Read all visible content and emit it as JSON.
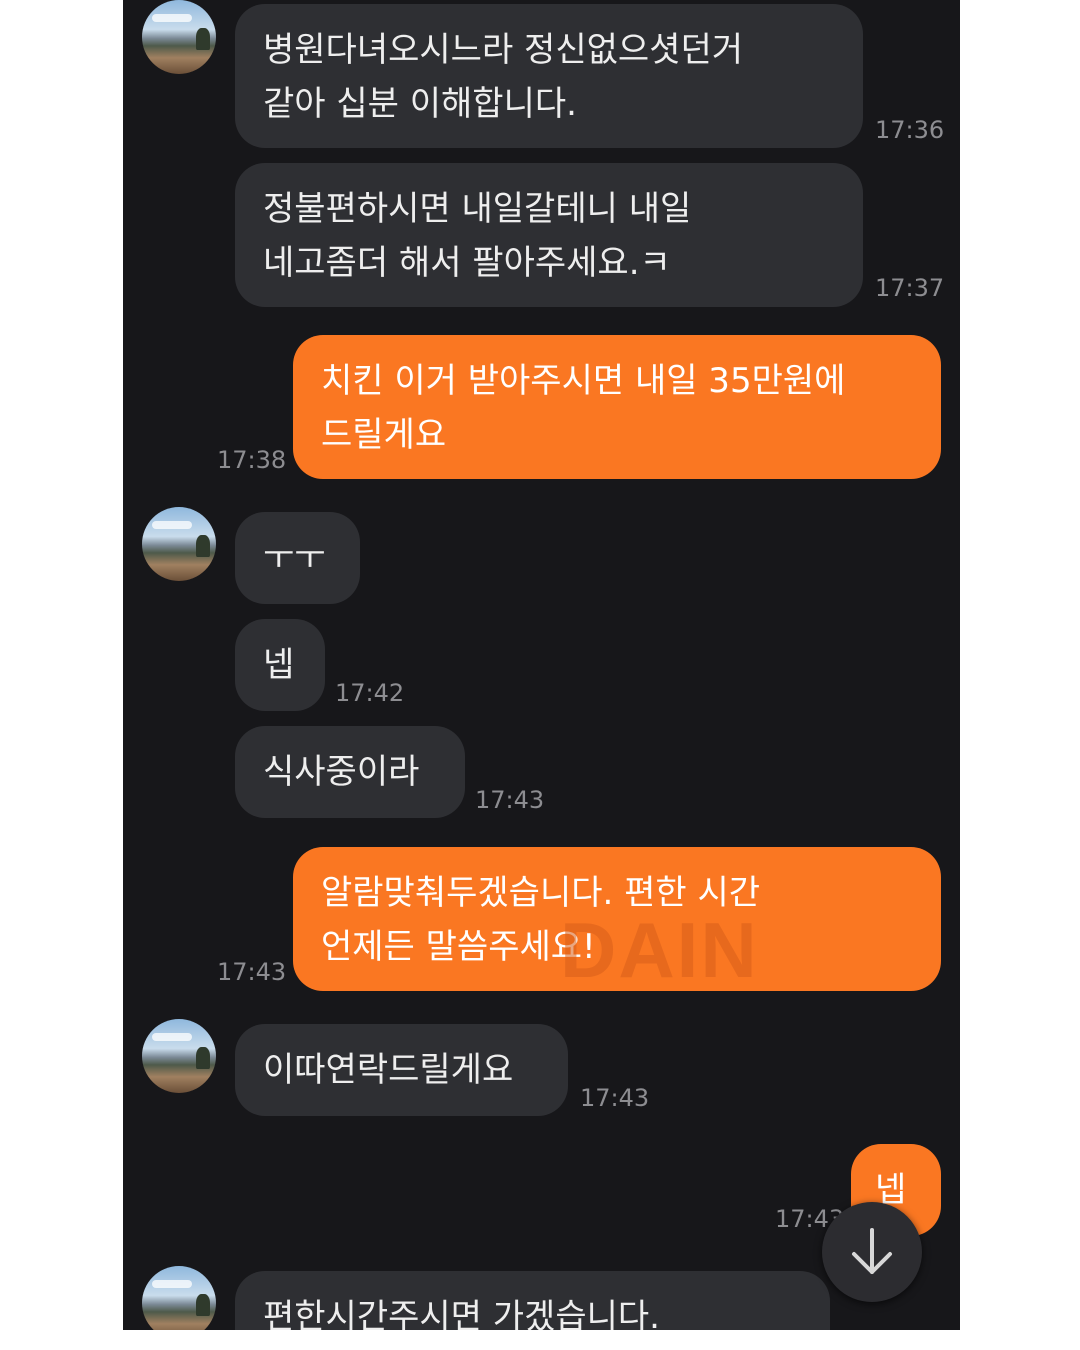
{
  "messages": [
    {
      "text": "병원다녀오시느라 정신없으셧던거\n같아 십분 이해합니다.",
      "time": "17:36"
    },
    {
      "text": "정불편하시면 내일갈테니 내일\n네고좀더 해서 팔아주세요.ㅋ",
      "time": "17:37"
    },
    {
      "text": "치킨 이거 받아주시면 내일 35만원에\n드릴게요",
      "time": "17:38"
    },
    {
      "text": "ㅜㅜ",
      "time": ""
    },
    {
      "text": "넵",
      "time": "17:42"
    },
    {
      "text": "식사중이라",
      "time": "17:43"
    },
    {
      "text": "알람맞춰두겠습니다. 편한 시간\n언제든 말씀주세요!",
      "time": "17:43"
    },
    {
      "text": "이따연락드릴게요",
      "time": "17:43"
    },
    {
      "text": "넵",
      "time": "17:43"
    },
    {
      "text": "편한시간주시면 가겠습니다.",
      "time": ""
    }
  ],
  "watermark": "DAIN",
  "icons": {
    "avatar": "avatar-landscape-photo",
    "scroll_down": "arrow-down-icon"
  },
  "colors": {
    "background": "#17171a",
    "incoming_bubble": "#2e2f33",
    "outgoing_bubble": "#fa7722"
  }
}
